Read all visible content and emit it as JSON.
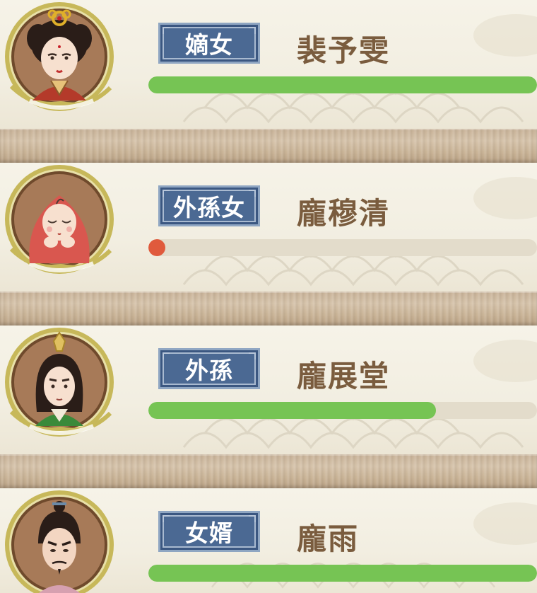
{
  "relatives": [
    {
      "relation": "嫡女",
      "name": "裴予雯",
      "avatar_icon": "noble-lady-portrait-icon",
      "bar_fraction": 1.0,
      "bar_color": "#76c454"
    },
    {
      "relation": "外孫女",
      "name": "龐穆清",
      "avatar_icon": "sleeping-baby-portrait-icon",
      "bar_fraction": 0.04,
      "bar_color": "#e05a3c"
    },
    {
      "relation": "外孫",
      "name": "龐展堂",
      "avatar_icon": "young-man-portrait-icon",
      "bar_fraction": 0.74,
      "bar_color": "#76c454"
    },
    {
      "relation": "女婿",
      "name": "龐雨",
      "avatar_icon": "bearded-man-portrait-icon",
      "bar_fraction": 1.0,
      "bar_color": "#76c454"
    }
  ]
}
